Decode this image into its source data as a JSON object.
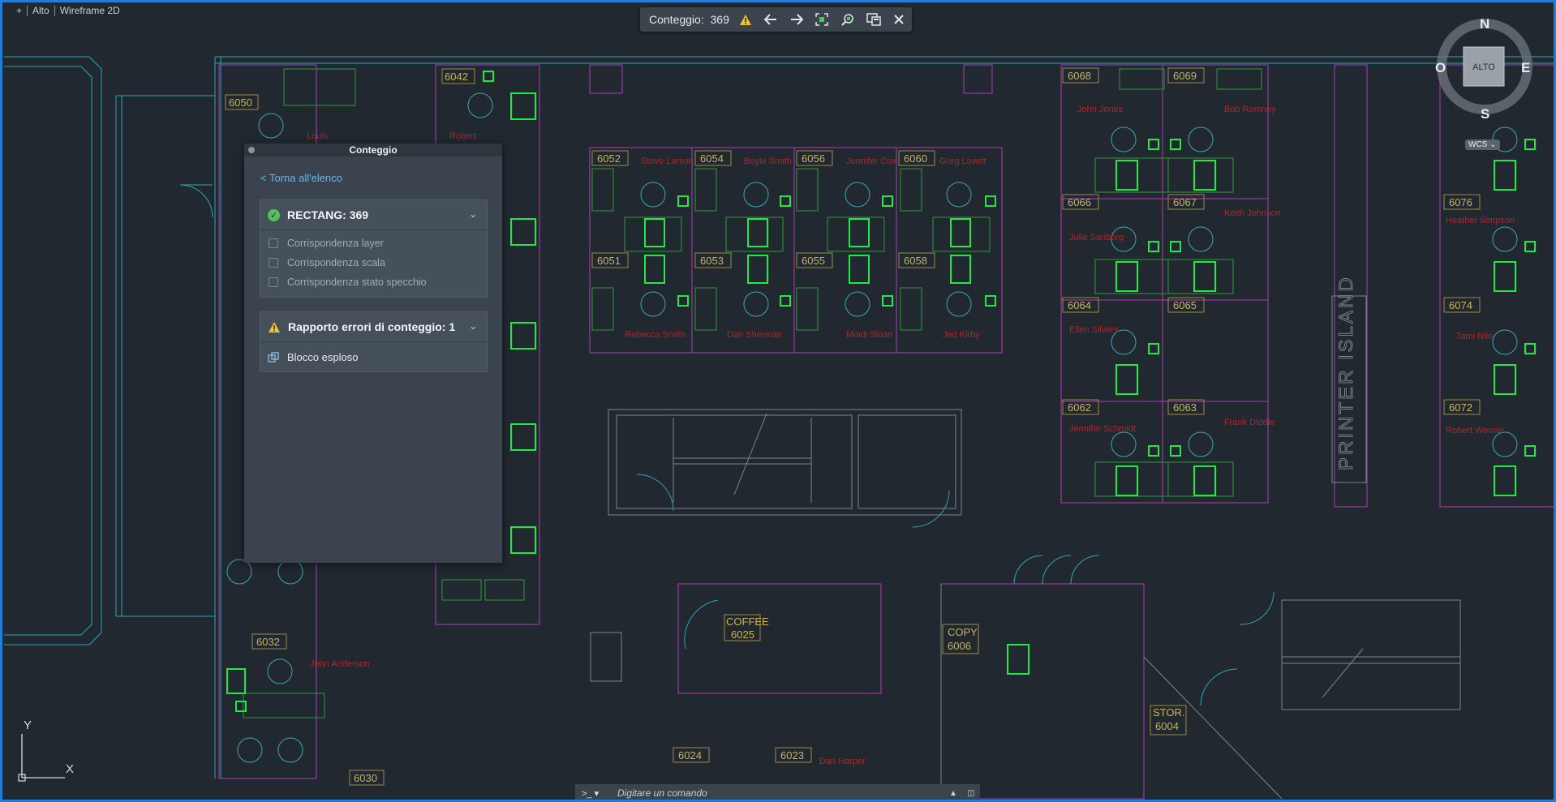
{
  "viewport": {
    "plus": "+",
    "view": "Alto",
    "visual_style": "Wireframe 2D"
  },
  "toolbar": {
    "label": "Conteggio:",
    "count": "369",
    "icons": [
      "warning-icon",
      "previous-arrow-icon",
      "next-arrow-icon",
      "zoom-extents-icon",
      "zoom-object-icon",
      "palette-icon",
      "close-icon"
    ]
  },
  "compass": {
    "north": "N",
    "south": "S",
    "east": "E",
    "west": "O",
    "center": "ALTO",
    "wcs": "WCS"
  },
  "panel": {
    "title": "Conteggio",
    "back": "< Torna all'elenco",
    "group": {
      "title": "RECTANG: 369",
      "options": [
        "Corrispondenza layer",
        "Corrispondenza scala",
        "Corrispondenza stato specchio"
      ]
    },
    "errors": {
      "title": "Rapporto errori di conteggio: 1",
      "item": "Blocco esploso"
    }
  },
  "command_line": {
    "prompt": ">_",
    "placeholder": "Digitare un comando"
  },
  "ucs": {
    "x": "X",
    "y": "Y"
  },
  "drawing": {
    "room_tags": [
      "6042",
      "6050",
      "6052",
      "6054",
      "6056",
      "6060",
      "6051",
      "6053",
      "6055",
      "6058",
      "6068",
      "6069",
      "6066",
      "6067",
      "6064",
      "6065",
      "6062",
      "6063",
      "6076",
      "6074",
      "6072",
      "6032",
      "6030",
      "6024",
      "6023",
      "COFFEE",
      "6025",
      "COPY",
      "6006",
      "STOR.",
      "6004"
    ],
    "names": [
      "Louis",
      "Robert",
      "Steve Larson",
      "Boyle Smith",
      "Jennifer Cox",
      "Greg Lovett",
      "Rebecca Smith",
      "Dan Sherman",
      "Mindi Sloan",
      "Jed Kirby",
      "John Jones",
      "Bob Romney",
      "Julie Sanborg",
      "Keith Johnson",
      "Ellen Silvers",
      "Jennifer Schmidt",
      "Frank Diddle",
      "Heather Simpson",
      "Tami Nilo",
      "Robert Werner",
      "John Anderson",
      "Dan Harper"
    ],
    "printer_island": "PRINTER ISLAND"
  }
}
